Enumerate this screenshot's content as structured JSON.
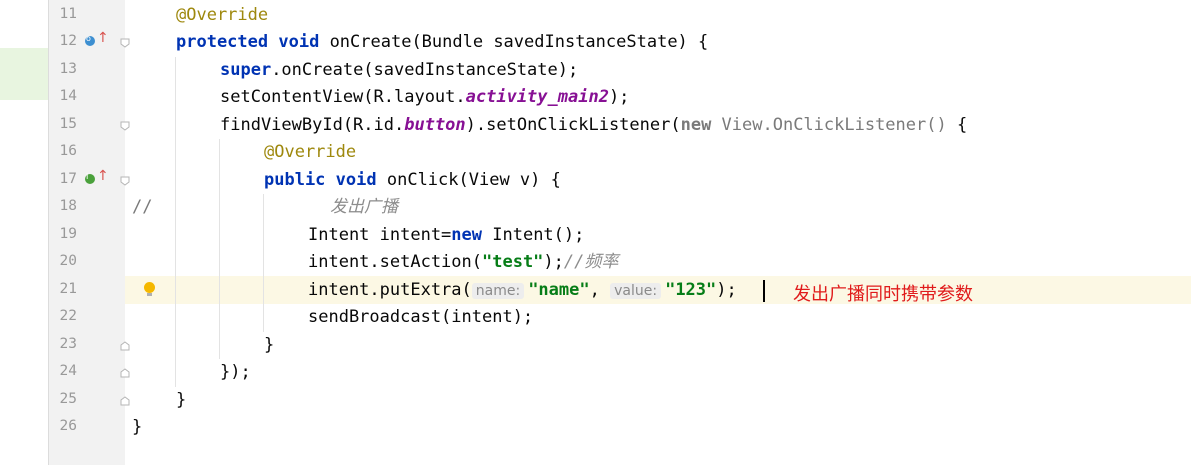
{
  "gutter": {
    "lines": [
      "11",
      "12",
      "13",
      "14",
      "15",
      "16",
      "17",
      "18",
      "19",
      "20",
      "21",
      "22",
      "23",
      "24",
      "25",
      "26"
    ],
    "override_marker_12": "o",
    "implements_marker_17": "I"
  },
  "code": {
    "l11": {
      "ann": "@Override"
    },
    "l12": {
      "kw1": "protected",
      "kw2": "void",
      "rest": " onCreate(Bundle savedInstanceState) {"
    },
    "l13": {
      "kw": "super",
      "rest": ".onCreate(savedInstanceState);"
    },
    "l14": {
      "pre": "setContentView(R.layout.",
      "field": "activity_main2",
      "post": ");"
    },
    "l15": {
      "pre": "findViewById(R.id.",
      "field": "button",
      "mid": ").setOnClickListener(",
      "kw": "new",
      "gray": " View.OnClickListener()",
      "post": " {"
    },
    "l16": {
      "ann": "@Override"
    },
    "l17": {
      "kw1": "public",
      "kw2": "void",
      "rest": " onClick(View v) {"
    },
    "l18": {
      "slashes": "//",
      "cmt": "发出广播"
    },
    "l19": {
      "pre": "Intent intent=",
      "kw": "new",
      "post": " Intent();"
    },
    "l20": {
      "pre": "intent.setAction(",
      "str": "\"test\"",
      "post": ");",
      "cmt": "//频率"
    },
    "l21": {
      "pre": "intent.putExtra(",
      "hint1": "name:",
      "str1": "\"name\"",
      "comma": ",",
      "hint2": "value:",
      "str2": "\"123\"",
      "post": ");"
    },
    "l22": {
      "text": "sendBroadcast(intent);"
    },
    "l23": {
      "text": "}"
    },
    "l24": {
      "text": "});"
    },
    "l25": {
      "text": "}"
    },
    "l26": {
      "text": "}"
    }
  },
  "annotation_note": "发出广播同时携带参数",
  "colors": {
    "keyword": "#0033b3",
    "annotation": "#9e880d",
    "string": "#067d17",
    "field": "#871094",
    "note": "#e01b1b",
    "current_line": "#fcf8e4"
  }
}
